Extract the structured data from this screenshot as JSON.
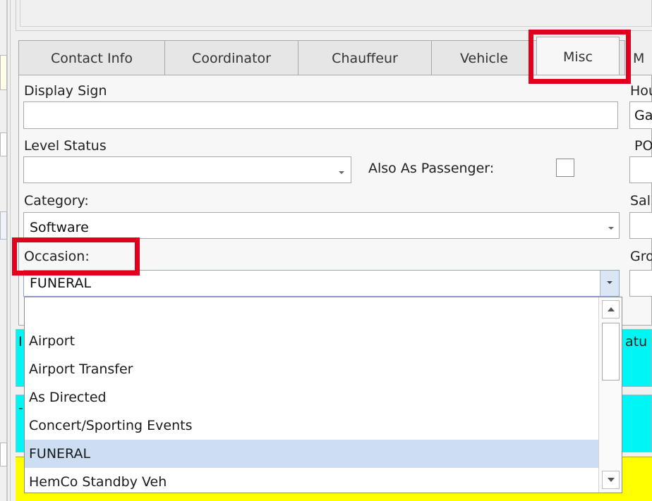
{
  "tabs": [
    {
      "label": "Contact Info",
      "active": false
    },
    {
      "label": "Coordinator",
      "active": false
    },
    {
      "label": "Chauffeur",
      "active": false
    },
    {
      "label": "Vehicle",
      "active": false
    },
    {
      "label": "Misc",
      "active": true
    },
    {
      "label": "M",
      "active": false
    }
  ],
  "form": {
    "display_sign": {
      "label": "Display Sign",
      "value": ""
    },
    "level_status": {
      "label": "Level Status",
      "value": ""
    },
    "also_as_passenger": {
      "label": "Also As Passenger:",
      "checked": false
    },
    "category": {
      "label": "Category:",
      "value": "Software"
    },
    "occasion": {
      "label": "Occasion:",
      "value": "FUNERAL"
    }
  },
  "right_column": {
    "labels": [
      "Hou",
      "PO",
      "Sal",
      "Gro"
    ],
    "values": [
      "Ga"
    ]
  },
  "occasion_dropdown": {
    "items": [
      "",
      "Airport",
      "Airport Transfer",
      "As Directed",
      "Concert/Sporting Events",
      "FUNERAL",
      "HemCo Standby Veh"
    ],
    "selected": "FUNERAL"
  },
  "background_rows": {
    "partial_left": "I",
    "partial_right": "atu",
    "partial_left_2": "-"
  },
  "colors": {
    "highlight": "#e0001b",
    "cyan_row": "#00f5f5",
    "yellow_row": "#ffff00",
    "selected_item": "#cdddf2"
  }
}
